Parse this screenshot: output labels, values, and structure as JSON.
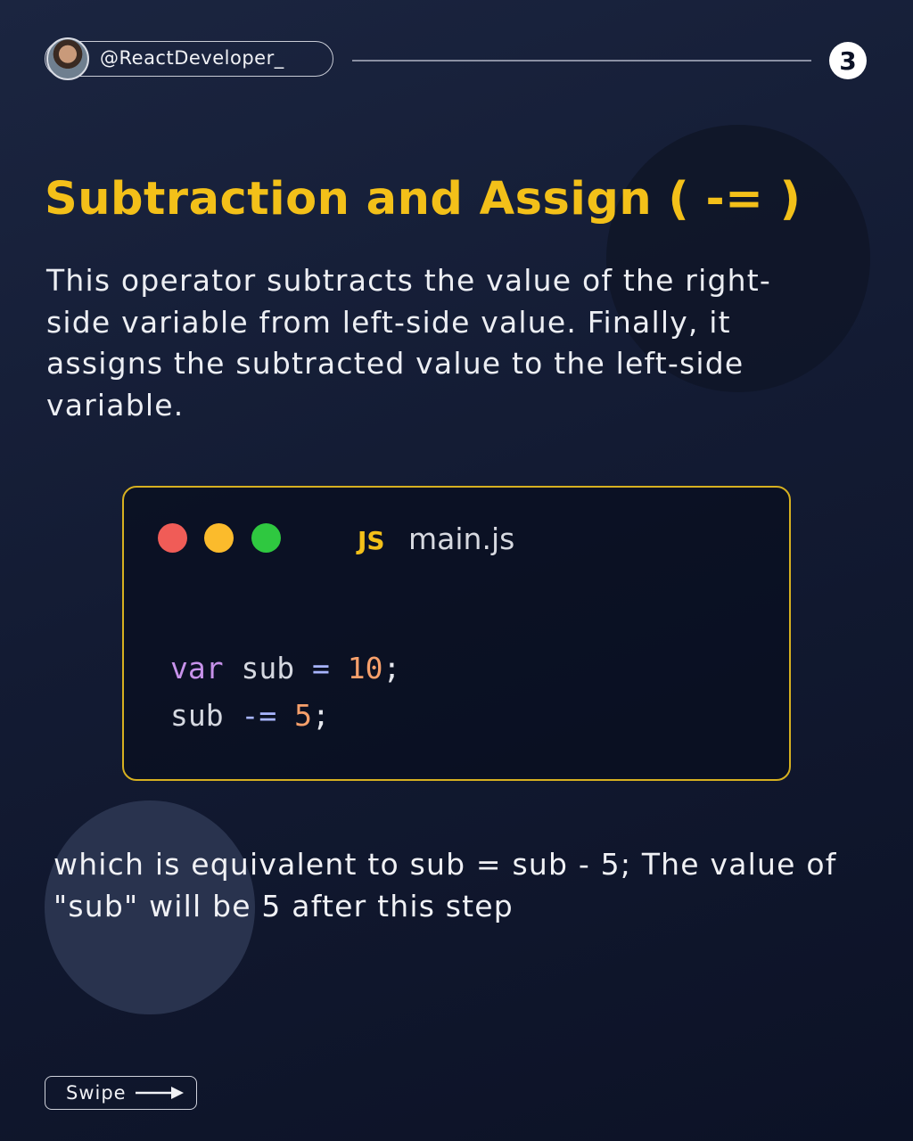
{
  "header": {
    "handle": "@ReactDeveloper_",
    "page_number": "3"
  },
  "title": "Subtraction and Assign ( -= )",
  "description": "This operator subtracts the value of the right-side variable from left-side value. Finally, it assigns the subtracted value to the left-side variable.",
  "code_window": {
    "language_badge": "JS",
    "filename": "main.js",
    "lines": [
      [
        {
          "text": "var",
          "kind": "kw"
        },
        {
          "text": " ",
          "kind": "space"
        },
        {
          "text": "sub",
          "kind": "id"
        },
        {
          "text": " ",
          "kind": "space"
        },
        {
          "text": "=",
          "kind": "op"
        },
        {
          "text": " ",
          "kind": "space"
        },
        {
          "text": "10",
          "kind": "num"
        },
        {
          "text": ";",
          "kind": "punct"
        }
      ],
      [
        {
          "text": "sub",
          "kind": "id"
        },
        {
          "text": " ",
          "kind": "space"
        },
        {
          "text": "-=",
          "kind": "op"
        },
        {
          "text": " ",
          "kind": "space"
        },
        {
          "text": "5",
          "kind": "num"
        },
        {
          "text": ";",
          "kind": "punct"
        }
      ]
    ]
  },
  "footer_note": "which is equivalent to sub = sub - 5; The value of \"sub\" will be 5 after this step",
  "swipe": {
    "label": "Swipe",
    "icon": "arrow-right-icon"
  },
  "colors": {
    "accent": "#f3c019",
    "window_dots": [
      "#f05c57",
      "#fbbb2c",
      "#2fc840"
    ]
  }
}
